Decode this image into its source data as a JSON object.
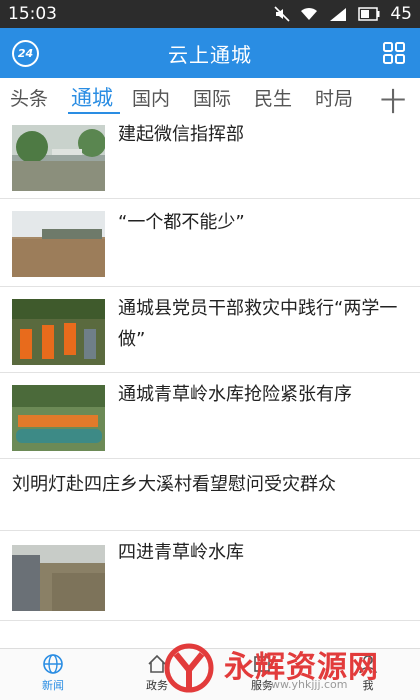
{
  "status": {
    "time": "15:03",
    "battery": "45"
  },
  "header": {
    "title": "云上通城",
    "badge": "24"
  },
  "tabs": [
    {
      "label": "头条"
    },
    {
      "label": "通城"
    },
    {
      "label": "国内"
    },
    {
      "label": "国际"
    },
    {
      "label": "民生"
    },
    {
      "label": "时局"
    }
  ],
  "tab_add": "十",
  "news": [
    {
      "title": "建起微信指挥部"
    },
    {
      "title": "“一个都不能少”"
    },
    {
      "title": "通城县党员干部救灾中践行“两学一做”"
    },
    {
      "title": " 通城青草岭水库抢险紧张有序"
    },
    {
      "title": "刘明灯赴四庄乡大溪村看望慰问受灾群众"
    },
    {
      "title": "四进青草岭水库"
    }
  ],
  "bottom_nav": [
    {
      "label": "新闻"
    },
    {
      "label": "政务"
    },
    {
      "label": "服务"
    },
    {
      "label": "我"
    }
  ],
  "watermark": {
    "text": "永辉资源网",
    "url": "www.yhkjjj.com"
  },
  "colors": {
    "accent": "#2a8de3",
    "watermark": "#e23b3b"
  }
}
